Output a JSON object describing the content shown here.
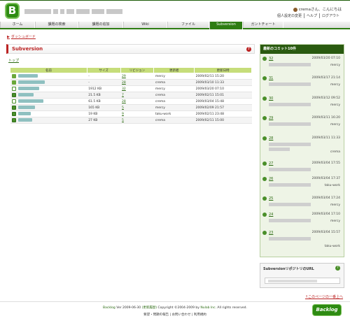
{
  "header": {
    "logo": "B",
    "user": "cremaさん、こんにちは",
    "links": [
      "個人設定の変更",
      "ヘルプ",
      "ログアウト"
    ]
  },
  "tabs": [
    {
      "label": "ホーム",
      "active": false
    },
    {
      "label": "課題の検索",
      "active": false
    },
    {
      "label": "課題の追加",
      "active": false
    },
    {
      "label": "Wiki",
      "active": false
    },
    {
      "label": "ファイル",
      "active": false
    },
    {
      "label": "Subversion",
      "active": true
    },
    {
      "label": "ガントチャート",
      "active": false
    }
  ],
  "breadcrumb": "ダッシュボード",
  "main": {
    "title": "Subversion",
    "help": "?",
    "top_link": "トップ",
    "columns": [
      "名前",
      "サイズ",
      "リビジョン",
      "更新者",
      "更新日時"
    ],
    "rows": [
      {
        "icon": "folder-icon",
        "size": "-",
        "revision": "29",
        "user": "mercy",
        "date": "2009/02/11 15:20"
      },
      {
        "icon": "folder-icon",
        "size": "-",
        "revision": "28",
        "user": "crema",
        "date": "2009/03/10 11:33"
      },
      {
        "icon": "file-link-icon",
        "size": "1912 KB",
        "revision": "32",
        "user": "mercy",
        "date": "2009/03/20 07:10"
      },
      {
        "icon": "file-icon",
        "size": "21.5 KB",
        "revision": "7",
        "user": "crema",
        "date": "2009/02/11 15:01"
      },
      {
        "icon": "file-link-icon",
        "size": "61.5 KB",
        "revision": "28",
        "user": "crema",
        "date": "2009/03/04 15:48"
      },
      {
        "icon": "file-icon",
        "size": "165 KB",
        "revision": "5",
        "user": "mercy",
        "date": "2009/02/09 21:57"
      },
      {
        "icon": "file-icon",
        "size": "19 KB",
        "revision": "9",
        "user": "taku-work",
        "date": "2009/02/11 23:48"
      },
      {
        "icon": "file-icon",
        "size": "27 KB",
        "revision": "5",
        "user": "crema",
        "date": "2009/02/11 15:00"
      }
    ]
  },
  "sidebar": {
    "title": "最新のコミット10件",
    "commits": [
      {
        "rev": "32",
        "date": "2009/03/20 07:10",
        "user": "mercy"
      },
      {
        "rev": "31",
        "date": "2009/03/17 21:14",
        "user": "mercy"
      },
      {
        "rev": "30",
        "date": "2009/03/12 09:52",
        "user": "mercy"
      },
      {
        "rev": "29",
        "date": "2009/03/11 16:20",
        "user": "mercy"
      },
      {
        "rev": "28",
        "date": "2009/03/11 11:33",
        "user": "crema"
      },
      {
        "rev": "27",
        "date": "2009/03/04 17:55",
        "user": ""
      },
      {
        "rev": "26",
        "date": "2009/03/04 17:37",
        "user": "taku-work"
      },
      {
        "rev": "25",
        "date": "2009/03/04 17:24",
        "user": "mercy"
      },
      {
        "rev": "24",
        "date": "2009/03/04 17:10",
        "user": "mercy"
      },
      {
        "rev": "23",
        "date": "2009/03/04 15:57",
        "user": "taku-work"
      }
    ]
  },
  "repo": {
    "title": "SubversionリポジトリのURL",
    "help": "?"
  },
  "page_top": "↑このページの一番上へ",
  "footer": {
    "line1_link": "Backlog",
    "line1_version": " Ver 2009-06-30 ",
    "line1_history": "(更新履歴)",
    "line1_copy": " Copyright ©2004-2009 by ",
    "line1_company": "Nulab Inc.",
    "line1_rights": " All rights reserved.",
    "line2": "要望・問題の報告 | お問い合わせ | 利用規約",
    "logo": "Backlog"
  }
}
